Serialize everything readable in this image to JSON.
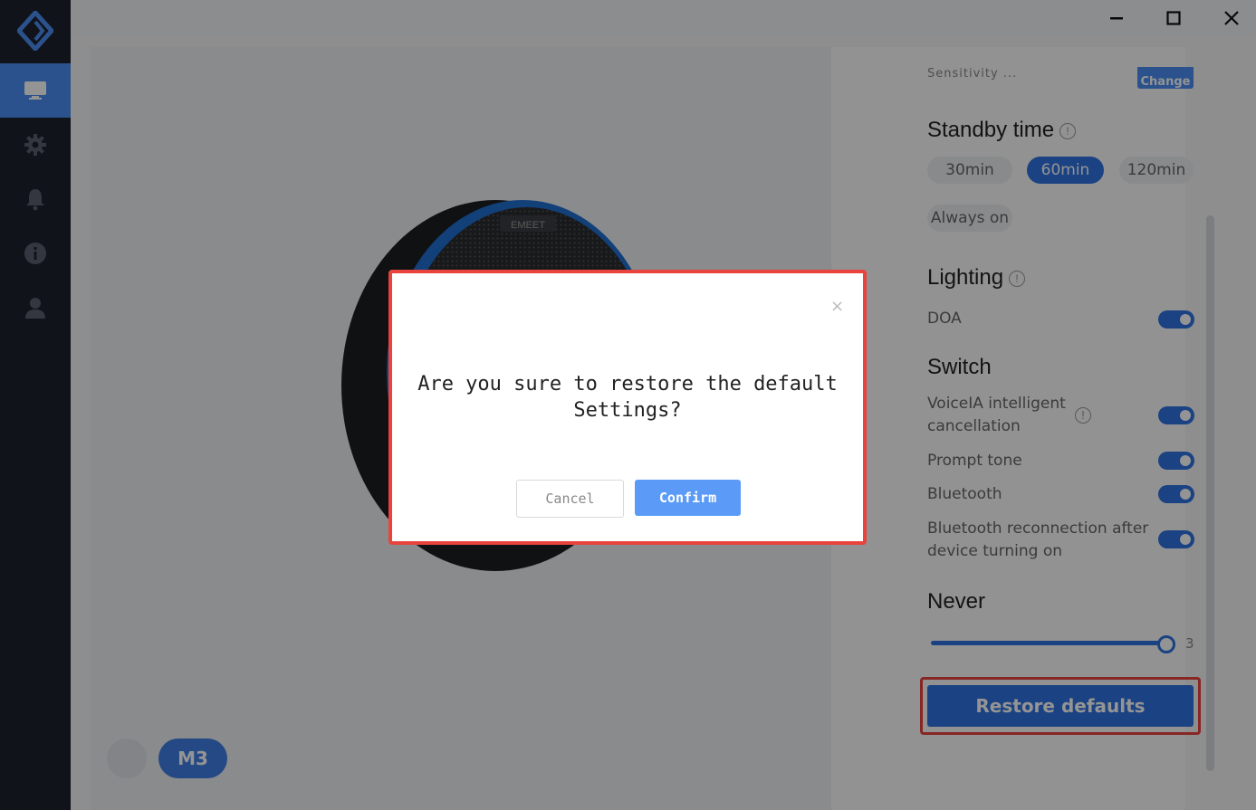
{
  "colors": {
    "accent": "#2f73e0",
    "sidebar_bg": "#1e2230",
    "highlight": "#e8433d",
    "overlay": "rgba(0,0,0,0.42)"
  },
  "sidebar": {
    "items": [
      {
        "name": "monitor-icon",
        "active": true
      },
      {
        "name": "gear-icon",
        "active": false
      },
      {
        "name": "bell-icon",
        "active": false
      },
      {
        "name": "info-icon",
        "active": false
      },
      {
        "name": "user-icon",
        "active": false
      }
    ]
  },
  "window_controls": [
    "minimize-icon",
    "maximize-icon",
    "close-icon"
  ],
  "device": {
    "chip_label": "M3",
    "brand_text": "EMEET"
  },
  "settings": {
    "truncated_label": "Sensitivity ...",
    "change_label": "Change",
    "standby": {
      "title": "Standby time",
      "options": [
        "30min",
        "60min",
        "120min",
        "Always on"
      ],
      "selected": "60min"
    },
    "lighting": {
      "title": "Lighting",
      "doa_label": "DOA",
      "doa_on": true
    },
    "switch": {
      "title": "Switch",
      "items": [
        {
          "label": "VoiceIA intelligent cancellation",
          "on": true
        },
        {
          "label": "Prompt tone",
          "on": true
        },
        {
          "label": "Bluetooth",
          "on": true
        },
        {
          "label": "Bluetooth reconnection after device turning on",
          "on": true
        }
      ]
    },
    "never": {
      "title": "Never",
      "slider_value": "3",
      "slider_fraction": 1.0
    },
    "restore_label": "Restore defaults"
  },
  "dialog": {
    "close_glyph": "×",
    "message": "Are you sure to restore the default Settings?",
    "cancel_label": "Cancel",
    "confirm_label": "Confirm"
  }
}
